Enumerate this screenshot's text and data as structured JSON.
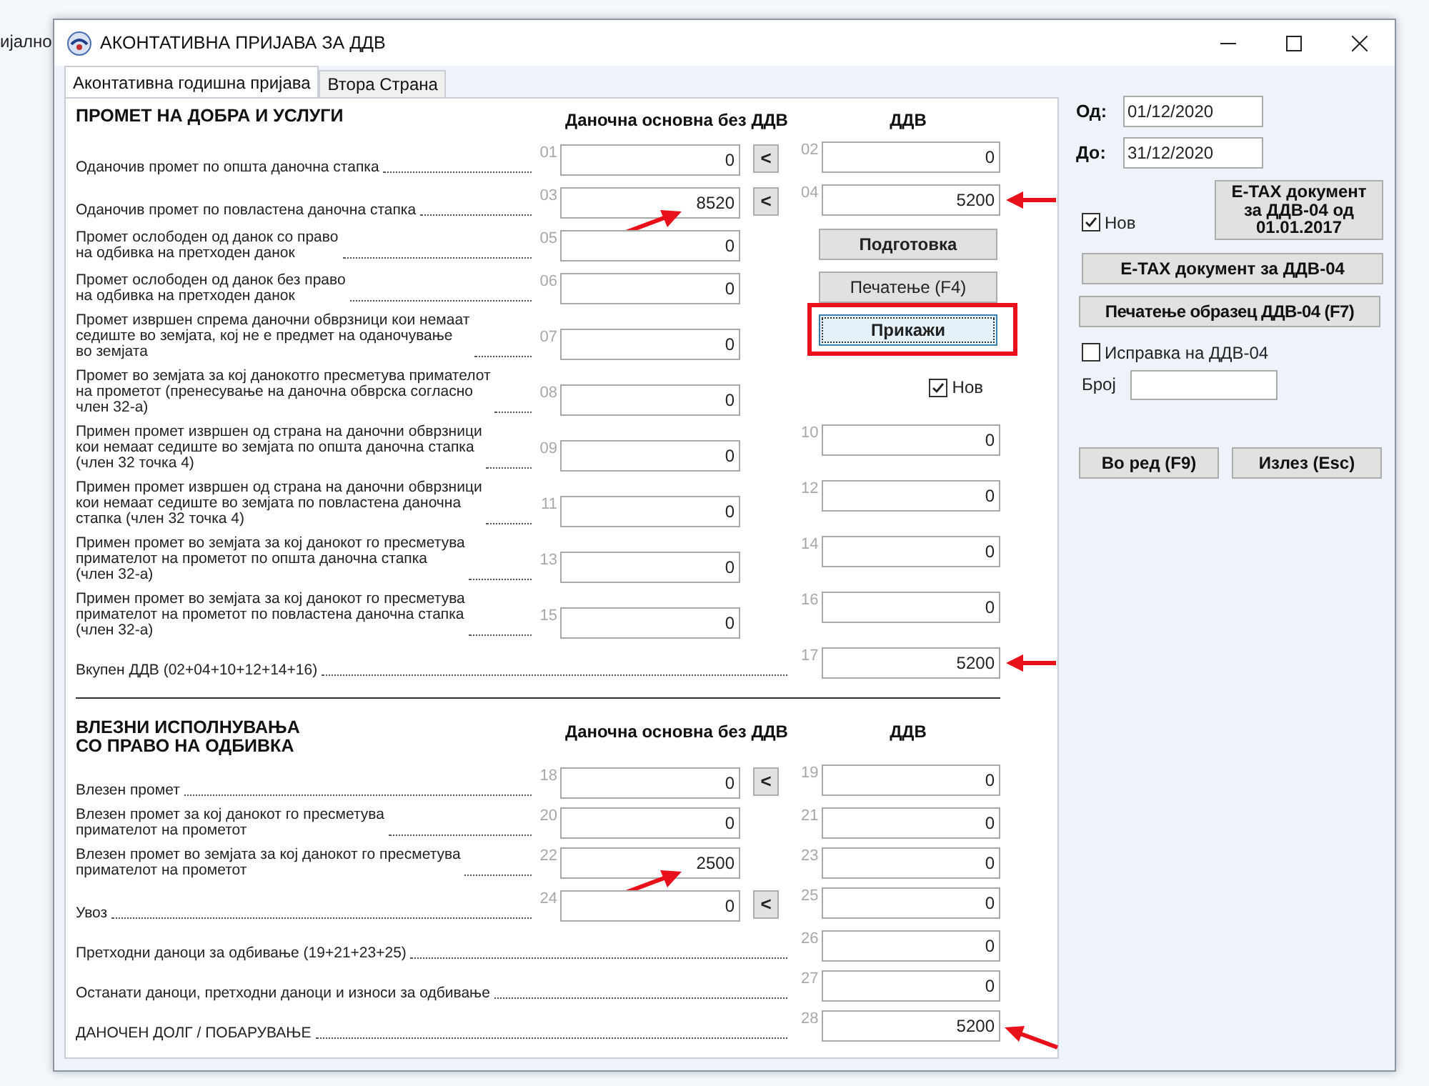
{
  "desktop_label": "ијално",
  "window": {
    "title": "АКОНТАТИВНА ПРИЈАВА ЗА ДДВ"
  },
  "tabs": [
    {
      "label": "Аконтативна годишна пријава",
      "selected": true
    },
    {
      "label": "Втора Страна",
      "selected": false
    }
  ],
  "sections": [
    {
      "title": "ПРОМЕТ НА ДОБРА И УСЛУГИ",
      "base_header": "Даночна основна без ДДВ",
      "vat_header": "ДДВ",
      "rows": [
        {
          "label": "Оданочив промет по општа даночна стапка",
          "base": {
            "code": "01",
            "value": "0"
          },
          "copy_button": "<",
          "vat": {
            "code": "02",
            "value": "0"
          }
        },
        {
          "label": "Оданочив промет по повластена даночна стапка",
          "base": {
            "code": "03",
            "value": "8520",
            "arrow": {
              "kind": "from_lower_left"
            }
          },
          "copy_button": "<",
          "vat": {
            "code": "04",
            "value": "5200",
            "arrow": {
              "kind": "from_right"
            }
          }
        },
        {
          "label": "Промет ослободен од данок со право\nна одбивка на претходен данок",
          "base": {
            "code": "05",
            "value": "0"
          },
          "extra": {
            "kind": "button",
            "label": "Подготовка",
            "bold": true,
            "focused": false,
            "highlighted": false
          }
        },
        {
          "label": "Промет ослободен од данок без право\nна одбивка на претходен данок",
          "base": {
            "code": "06",
            "value": "0"
          },
          "extra": {
            "kind": "button",
            "label": "Печатење (F4)",
            "bold": false,
            "focused": false,
            "highlighted": false
          }
        },
        {
          "label": "Промет извршен спрема даночни обврзници кои немаат\nседиште во земјата, кој не е предмет на оданочување\nво земјата",
          "base": {
            "code": "07",
            "value": "0"
          },
          "extra": {
            "kind": "button",
            "label": "Прикажи",
            "bold": true,
            "focused": true,
            "highlighted": true
          }
        },
        {
          "label": "Промет во земјата за кој данокотго пресметува примателот\nна прометот (пренесување на даночна обврска согласно\nчлен 32-а)",
          "base": {
            "code": "08",
            "value": "0"
          },
          "extra": {
            "kind": "checkbox",
            "label": "Нов",
            "checked": true
          }
        },
        {
          "label": "Примен промет извршен од страна на даночни обврзници\nкои немаат седиште во земјата по општа даночна стапка\n(член 32 точка 4)",
          "base": {
            "code": "09",
            "value": "0"
          },
          "vat": {
            "code": "10",
            "value": "0"
          }
        },
        {
          "label": "Примен промет извршен од страна на даночни обврзници\nкои немаат седиште во земјата по повластена даночна\nстапка (член 32 точка 4)",
          "base": {
            "code": "11",
            "value": "0"
          },
          "vat": {
            "code": "12",
            "value": "0"
          }
        },
        {
          "label": "Примен промет во земјата за кој данокот го пресметува\nпримателот на прометот по општа даночна стапка\n(член 32-а)",
          "base": {
            "code": "13",
            "value": "0"
          },
          "vat": {
            "code": "14",
            "value": "0"
          }
        },
        {
          "label": "Примен промет во земјата за кој данокот го пресметува\nпримателот на прометот по повластена даночна стапка\n(член 32-а)",
          "base": {
            "code": "15",
            "value": "0"
          },
          "vat": {
            "code": "16",
            "value": "0"
          }
        },
        {
          "label": "Вкупен ДДВ (02+04+10+12+14+16)",
          "vat": {
            "code": "17",
            "value": "5200",
            "arrow": {
              "kind": "from_right"
            }
          }
        }
      ]
    },
    {
      "title": "ВЛЕЗНИ ИСПОЛНУВАЊА\nСО ПРАВО НА ОДБИВКА",
      "base_header": "Даночна основна без ДДВ",
      "vat_header": "ДДВ",
      "rows": [
        {
          "label": "Влезен промет",
          "base": {
            "code": "18",
            "value": "0"
          },
          "copy_button": "<",
          "vat": {
            "code": "19",
            "value": "0"
          }
        },
        {
          "label": "Влезен промет за кој данокот го пресметува\nпримателот на прометот",
          "base": {
            "code": "20",
            "value": "0"
          },
          "vat": {
            "code": "21",
            "value": "0"
          }
        },
        {
          "label": "Влезен промет во земјата за кој данокот го пресметува\nпримателот на прометот",
          "base": {
            "code": "22",
            "value": "2500",
            "arrow": {
              "kind": "from_lower_left"
            }
          },
          "vat": {
            "code": "23",
            "value": "0"
          }
        },
        {
          "label": "Увоз",
          "base": {
            "code": "24",
            "value": "0"
          },
          "copy_button": "<",
          "vat": {
            "code": "25",
            "value": "0"
          }
        },
        {
          "label": "Претходни даноци за одбивање (19+21+23+25)",
          "vat": {
            "code": "26",
            "value": "0"
          }
        },
        {
          "label": "Останати даноци, претходни даноци и износи за одбивање",
          "vat": {
            "code": "27",
            "value": "0"
          }
        },
        {
          "label": "ДАНОЧЕН ДОЛГ / ПОБАРУВАЊЕ",
          "vat": {
            "code": "28",
            "value": "5200",
            "arrow": {
              "kind": "from_lower_right"
            }
          }
        }
      ]
    }
  ],
  "period": [
    {
      "label": "Од:",
      "value": "01/12/2020"
    },
    {
      "label": "До:",
      "value": "31/12/2020"
    }
  ],
  "etax_2017_button": {
    "lines": [
      "E-TAX документ",
      "за ДДВ-04 од",
      "01.01.2017"
    ]
  },
  "new_checkbox": {
    "label": "Нов",
    "checked": true
  },
  "etax_button": "E-TAX документ за ДДВ-04",
  "print_button": "Печатење образец ДДВ-04 (F7)",
  "correction_checkbox": {
    "label": "Исправка на ДДВ-04",
    "checked": false
  },
  "number_field": {
    "label": "Број"
  },
  "buttons": [
    "Во ред (F9)",
    "Излез (Esc)"
  ]
}
